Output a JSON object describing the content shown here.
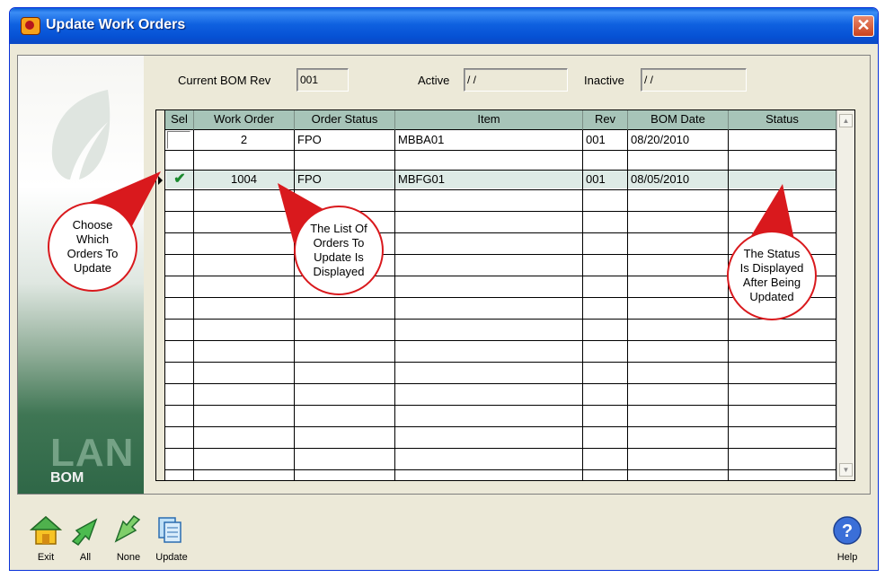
{
  "window": {
    "title": "Update Work Orders",
    "close_glyph": "✕"
  },
  "header": {
    "current_bom_rev_label": "Current BOM Rev",
    "current_bom_rev_value": "001",
    "active_label": "Active",
    "active_value": "/ /",
    "inactive_label": "Inactive",
    "inactive_value": "/ /"
  },
  "branding": {
    "lan": "LAN",
    "bom": "BOM"
  },
  "grid": {
    "columns": [
      "Sel",
      "Work Order",
      "Order Status",
      "Item",
      "Rev",
      "BOM Date",
      "Status"
    ],
    "rows": [
      {
        "sel": "",
        "work_order": "2",
        "order_status": "FPO",
        "item": "MBBA01",
        "rev": "001",
        "bom_date": "08/20/2010",
        "status": ""
      },
      {
        "sel": "✔",
        "work_order": "1004",
        "order_status": "FPO",
        "item": "MBFG01",
        "rev": "001",
        "bom_date": "08/05/2010",
        "status": ""
      }
    ],
    "scroll_up_glyph": "▲",
    "scroll_down_glyph": "▼"
  },
  "callouts": {
    "choose": "Choose\nWhich\nOrders To\nUpdate",
    "list": "The List Of\nOrders To\nUpdate Is\nDisplayed",
    "status": "The Status\nIs Displayed\nAfter Being\nUpdated"
  },
  "toolbar": {
    "exit_label": "Exit",
    "all_label": "All",
    "none_label": "None",
    "update_label": "Update",
    "help_label": "Help",
    "help_glyph": "?"
  },
  "colors": {
    "header_bg": "#a7c4b8",
    "callout_red": "#d9191d",
    "titlebar": "#0a5fd8",
    "check_green": "#1a8a2e"
  }
}
